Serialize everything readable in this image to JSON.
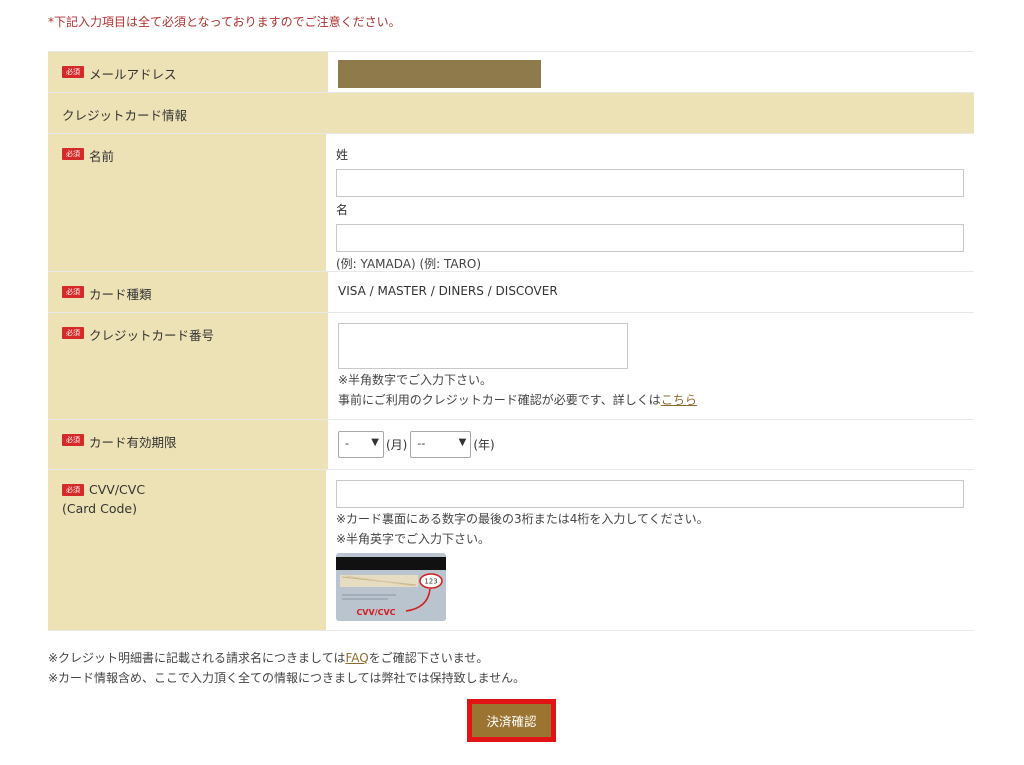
{
  "notice_top": "*下記入力項目は全て必須となっておりますのでご注意ください。",
  "required_badge": "必須",
  "rows": {
    "email": {
      "label": "メールアドレス"
    },
    "cc_section": {
      "label": "クレジットカード情報"
    },
    "name": {
      "label": "名前",
      "last_label": "姓",
      "first_label": "名",
      "example": "(例: YAMADA) (例: TARO)"
    },
    "card_type": {
      "label": "カード種類",
      "value": "VISA / MASTER / DINERS / DISCOVER"
    },
    "card_number": {
      "label": "クレジットカード番号",
      "hint1": "※半角数字でご入力下さい。",
      "hint2": "事前にご利用のクレジットカード確認が必要です、詳しくは",
      "hint2_link": "こちら"
    },
    "expiry": {
      "label": "カード有効期限",
      "month_value": "-",
      "month_suffix": "(月)",
      "year_value": "--",
      "year_suffix": "(年)"
    },
    "cvv": {
      "label": "CVV/CVC",
      "sublabel": "(Card Code)",
      "hint1": "※カード裏面にある数字の最後の3桁または4桁を入力してください。",
      "hint2": "※半角英字でご入力下さい。",
      "image_number": "123",
      "image_caption": "CVV/CVC"
    }
  },
  "notes": {
    "line1_before": "※クレジット明細書に記載される請求名につきましては",
    "line1_link": "FAQ",
    "line1_after": "をご確認下さいませ。",
    "line2": "※カード情報含め、ここで入力頂く全ての情報につきましては弊社では保持致しません。"
  },
  "submit_label": "決済確認",
  "colors": {
    "label_bg": "#ede2b6",
    "required_badge": "#d62a2a",
    "submit_bg": "#9a7430",
    "highlight_border": "#e01414",
    "masked_email": "#8e7a4a"
  }
}
